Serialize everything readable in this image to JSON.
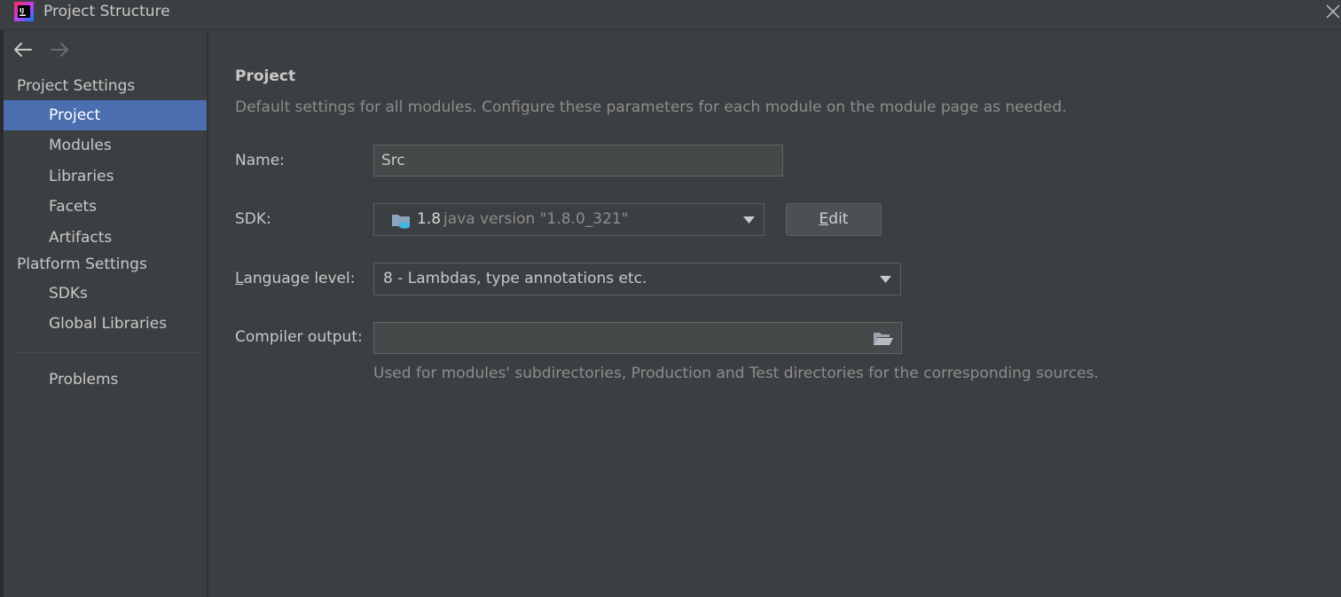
{
  "window": {
    "title": "Project Structure",
    "app_icon": "intellij-icon",
    "close_icon": "close-icon"
  },
  "sidebar": {
    "back_icon": "arrow-left-icon",
    "forward_icon": "arrow-right-icon",
    "groups": [
      {
        "title": "Project Settings",
        "items": [
          "Project",
          "Modules",
          "Libraries",
          "Facets",
          "Artifacts"
        ]
      },
      {
        "title": "Platform Settings",
        "items": [
          "SDKs",
          "Global Libraries"
        ]
      }
    ],
    "problems_label": "Problems",
    "selected": "Project",
    "selected_color": "#4b6eaf"
  },
  "main": {
    "title": "Project",
    "description": "Default settings for all modules. Configure these parameters for each module on the module page as needed.",
    "name": {
      "label": "Name:",
      "value": "Src"
    },
    "sdk": {
      "label": "SDK:",
      "version": "1.8",
      "detail": "java version \"1.8.0_321\"",
      "icon": "sdk-folder-icon",
      "edit_label": "Edit",
      "edit_mnemonic": "E",
      "edit_rest": "dit"
    },
    "language_level": {
      "label": "Language level:",
      "label_mnemonic": "L",
      "label_rest": "anguage level:",
      "value": "8 - Lambdas, type annotations etc."
    },
    "compiler_output": {
      "label": "Compiler output:",
      "value": "",
      "browse_icon": "folder-open-icon",
      "hint": "Used for modules' subdirectories, Production and Test directories for the corresponding sources."
    }
  }
}
